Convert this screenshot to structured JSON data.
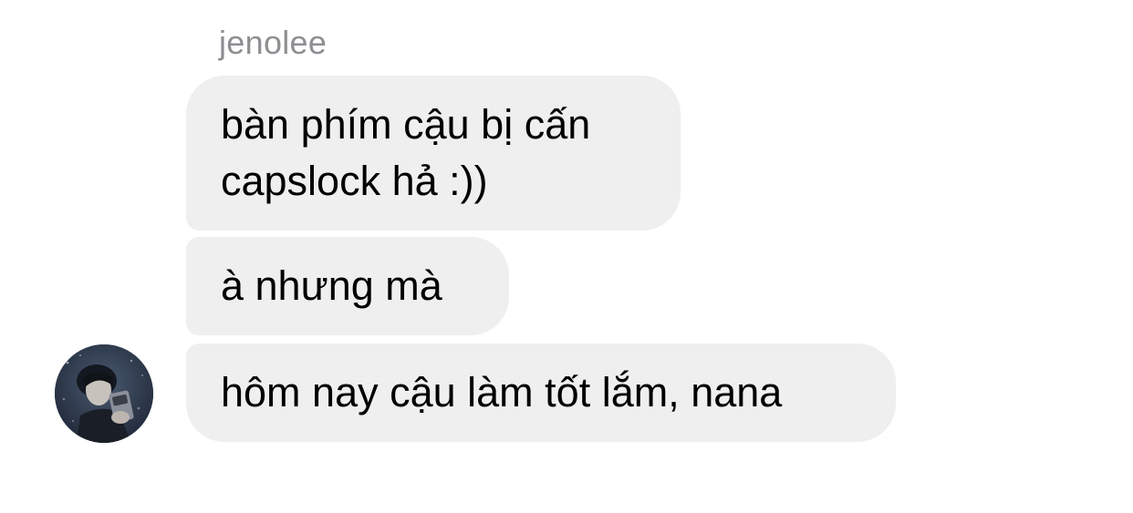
{
  "conversation": {
    "sender_name": "jenolee",
    "messages": [
      {
        "lines": [
          "bàn phím cậu bị cấn",
          "capslock hả :))"
        ]
      },
      {
        "lines": [
          "à nhưng mà"
        ]
      },
      {
        "lines": [
          "hôm nay cậu làm tốt lắm, nana"
        ]
      }
    ],
    "avatar": {
      "icon": "user-avatar-photo"
    }
  },
  "colors": {
    "bubble_background": "#efefef",
    "sender_name": "#8e8e93",
    "message_text": "#000000",
    "background": "#ffffff"
  }
}
